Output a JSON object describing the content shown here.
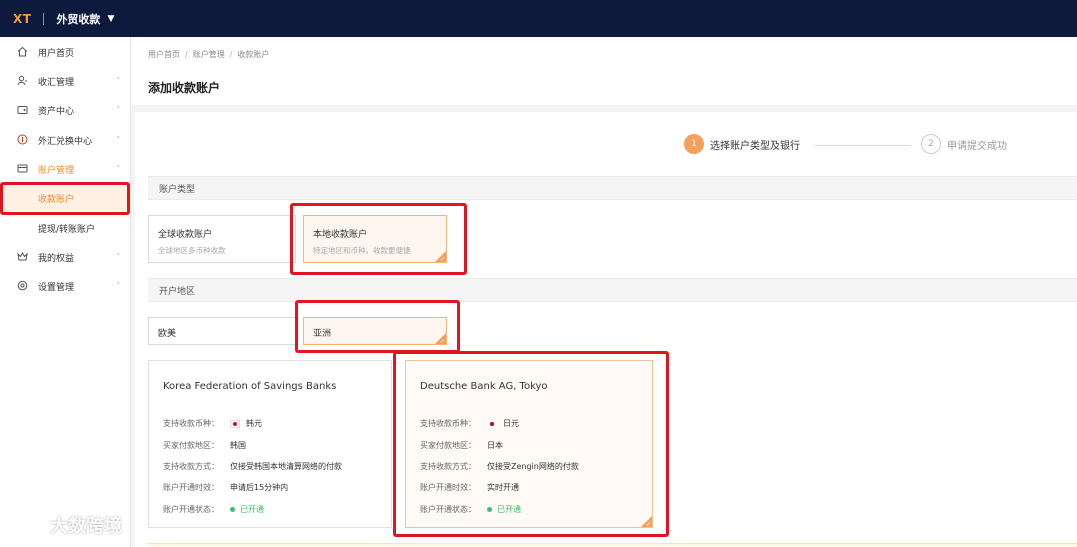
{
  "topbar": {
    "logo": "XT",
    "app_name": "外贸收款"
  },
  "sidebar": {
    "items": [
      {
        "label": "用户首页",
        "icon": "home-icon"
      },
      {
        "label": "收汇管理",
        "icon": "user-icon",
        "caret": "˅"
      },
      {
        "label": "资产中心",
        "icon": "wallet-icon",
        "caret": "˅"
      },
      {
        "label": "外汇兑换中心",
        "icon": "exchange-icon",
        "caret": "˅"
      },
      {
        "label": "账户管理",
        "icon": "card-icon",
        "caret": "˄"
      },
      {
        "label": "收款账户"
      },
      {
        "label": "提现/转账账户"
      },
      {
        "label": "我的权益",
        "icon": "crown-icon",
        "caret": "˅"
      },
      {
        "label": "设置管理",
        "icon": "settings-icon",
        "caret": "˅"
      }
    ]
  },
  "breadcrumb": [
    "用户首页",
    "账户管理",
    "收款账户"
  ],
  "page_title": "添加收款账户",
  "steps": [
    {
      "num": "1",
      "label": "选择账户类型及银行"
    },
    {
      "num": "2",
      "label": "申请提交成功"
    }
  ],
  "account_type": {
    "section_label": "账户类型",
    "options": [
      {
        "title": "全球收款账户",
        "subtitle": "全球地区多币种收款"
      },
      {
        "title": "本地收款账户",
        "subtitle": "特定地区和币种，收款更便捷"
      }
    ]
  },
  "region": {
    "section_label": "开户地区",
    "options": [
      "欧美",
      "亚洲"
    ]
  },
  "banks": [
    {
      "name": "Korea Federation of Savings Banks",
      "rows": [
        {
          "key": "支持收款币种：",
          "value": "韩元"
        },
        {
          "key": "买家付款地区：",
          "value": "韩国"
        },
        {
          "key": "支持收款方式：",
          "value": "仅接受韩国本地清算网络的付款"
        },
        {
          "key": "账户开通时效：",
          "value": "申请后15分钟内"
        },
        {
          "key": "账户开通状态：",
          "value": "已开通"
        }
      ]
    },
    {
      "name": "Deutsche Bank AG, Tokyo",
      "rows": [
        {
          "key": "支持收款币种：",
          "value": "日元"
        },
        {
          "key": "买家付款地区：",
          "value": "日本"
        },
        {
          "key": "支持收款方式：",
          "value": "仅接受Zengin网络的付款"
        },
        {
          "key": "账户开通时效：",
          "value": "实时开通"
        },
        {
          "key": "账户开通状态：",
          "value": "已开通"
        }
      ]
    }
  ],
  "watermark": "大数跨境",
  "colors": {
    "accent": "#f08a2c",
    "topbar": "#0e1a3d",
    "highlight": "#e3141f",
    "status_green": "#3cbf6a"
  }
}
